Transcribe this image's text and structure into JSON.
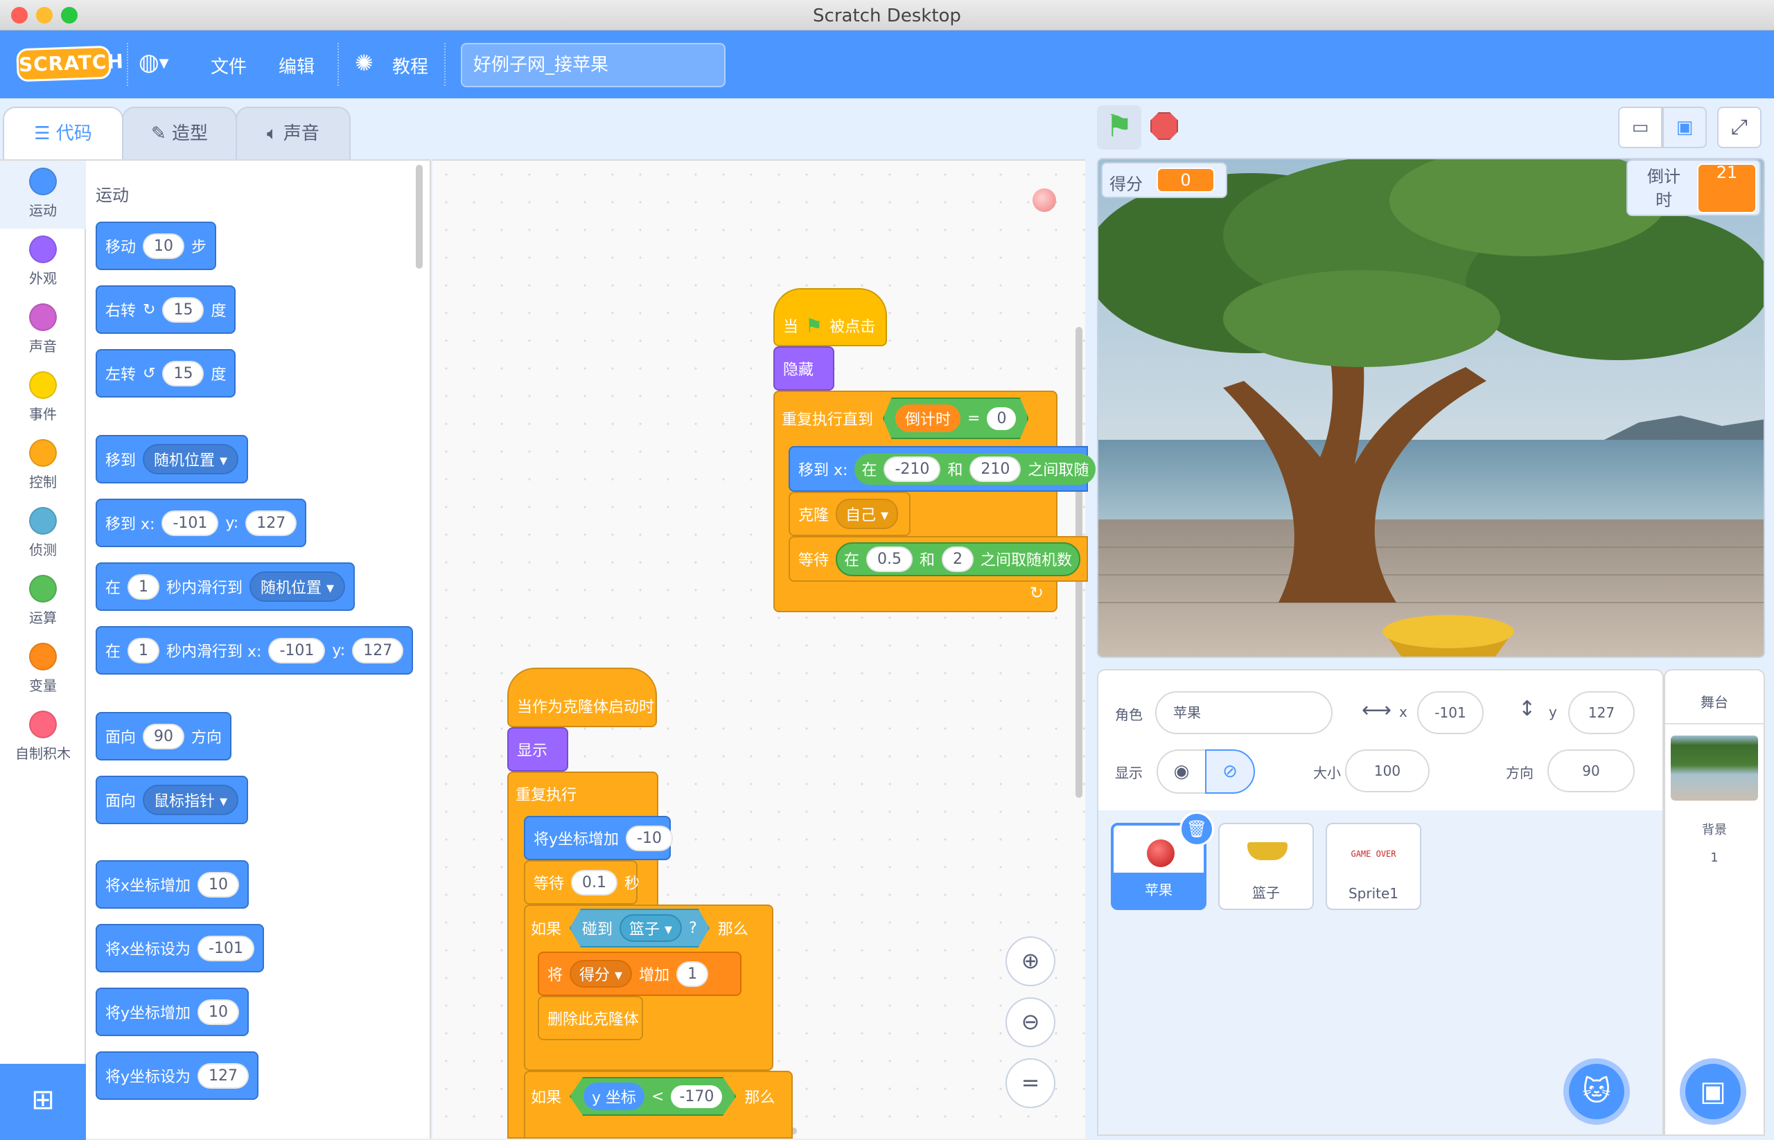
{
  "window": {
    "title": "Scratch Desktop"
  },
  "menu": {
    "logo": "SCRATCH",
    "file": "文件",
    "edit": "编辑",
    "tutorials": "教程",
    "project_title": "好例子网_接苹果"
  },
  "tabs": {
    "code": "代码",
    "costumes": "造型",
    "sounds": "声音"
  },
  "categories": [
    {
      "label": "运动",
      "color": "#4c97ff"
    },
    {
      "label": "外观",
      "color": "#9966ff"
    },
    {
      "label": "声音",
      "color": "#cf63cf"
    },
    {
      "label": "事件",
      "color": "#ffd500"
    },
    {
      "label": "控制",
      "color": "#ffab19"
    },
    {
      "label": "侦测",
      "color": "#5cb1d6"
    },
    {
      "label": "运算",
      "color": "#59c059"
    },
    {
      "label": "变量",
      "color": "#ff8c1a"
    },
    {
      "label": "自制积木",
      "color": "#ff6680"
    }
  ],
  "palette": {
    "section": "运动",
    "b1": {
      "a": "移动",
      "v": "10",
      "b": "步"
    },
    "b2": {
      "a": "右转",
      "icon": "↻",
      "v": "15",
      "b": "度"
    },
    "b3": {
      "a": "左转",
      "icon": "↺",
      "v": "15",
      "b": "度"
    },
    "b4": {
      "a": "移到",
      "d": "随机位置 ▾"
    },
    "b5": {
      "a": "移到 x:",
      "x": "-101",
      "ylab": "y:",
      "y": "127"
    },
    "b6": {
      "a": "在",
      "v": "1",
      "b": "秒内滑行到",
      "d": "随机位置 ▾"
    },
    "b7": {
      "a": "在",
      "v": "1",
      "b": "秒内滑行到 x:",
      "x": "-101",
      "ylab": "y:",
      "y": "127"
    },
    "b8": {
      "a": "面向",
      "v": "90",
      "b": "方向"
    },
    "b9": {
      "a": "面向",
      "d": "鼠标指针 ▾"
    },
    "b10": {
      "a": "将x坐标增加",
      "v": "10"
    },
    "b11": {
      "a": "将x坐标设为",
      "v": "-101"
    },
    "b12": {
      "a": "将y坐标增加",
      "v": "10"
    },
    "b13": {
      "a": "将y坐标设为",
      "v": "127"
    }
  },
  "script1": {
    "hat": {
      "a": "当",
      "b": "被点击"
    },
    "hide": "隐藏",
    "repeat_until": "重复执行直到",
    "var": "倒计时",
    "eq": "=",
    "zero": "0",
    "goto": "移到 x:",
    "in": "在",
    "n1": "-210",
    "and": "和",
    "n2": "210",
    "rand": "之间取随",
    "clone": "克隆",
    "self": "自己 ▾",
    "wait": "等待",
    "w1": "0.5",
    "w2": "2",
    "rand2": "之间取随机数"
  },
  "script2": {
    "hat": "当作为克隆体启动时",
    "show": "显示",
    "forever": "重复执行",
    "changey": "将y坐标增加",
    "cy": "-10",
    "wait": "等待",
    "wv": "0.1",
    "sec": "秒",
    "if": "如果",
    "touch": "碰到",
    "basket": "篮子 ▾",
    "q": "?",
    "then": "那么",
    "set": "将",
    "score": "得分 ▾",
    "inc": "增加",
    "one": "1",
    "del": "删除此克隆体",
    "if2": "如果",
    "ycoord": "y 坐标",
    "lt": "<",
    "m170": "-170",
    "then2": "那么"
  },
  "stage": {
    "score_label": "得分",
    "score_value": "0",
    "timer_label": "倒计时",
    "timer_value": "21"
  },
  "sprite_info": {
    "sprite_label": "角色",
    "sprite_name": "苹果",
    "x_label": "x",
    "x": "-101",
    "y_label": "y",
    "y": "127",
    "show_label": "显示",
    "size_label": "大小",
    "size": "100",
    "direction_label": "方向",
    "direction": "90"
  },
  "sprites": [
    {
      "name": "苹果"
    },
    {
      "name": "篮子"
    },
    {
      "name": "Sprite1",
      "thumb_text": "GAME OVER"
    }
  ],
  "stage_panel": {
    "title": "舞台",
    "backdrop_label": "背景",
    "backdrop_count": "1"
  }
}
